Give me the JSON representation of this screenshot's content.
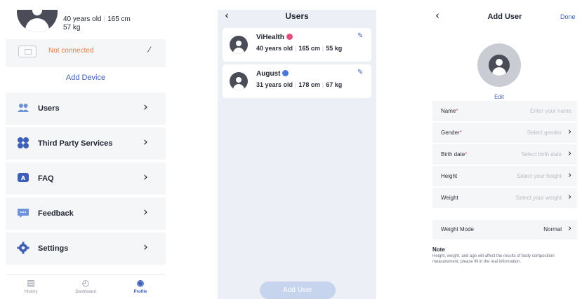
{
  "profile_screen": {
    "user_stats": {
      "age": "40 years old",
      "height": "165 cm",
      "weight": "57 kg"
    },
    "device": {
      "status": "Not connected",
      "edit_icon": "pencil-icon"
    },
    "add_device_label": "Add Device",
    "menu": [
      {
        "label": "Users",
        "icon": "users-icon",
        "color": "#6e93d6"
      },
      {
        "label": "Third Party Services",
        "icon": "grid-icon",
        "color": "#3d5fb7"
      },
      {
        "label": "FAQ",
        "icon": "faq-icon",
        "color": "#3d5fb7"
      },
      {
        "label": "Feedback",
        "icon": "chat-icon",
        "color": "#6e93d6"
      },
      {
        "label": "Settings",
        "icon": "gear-icon",
        "color": "#3d5fb7"
      }
    ],
    "tabs": [
      {
        "label": "History",
        "icon": "history-icon",
        "active": false
      },
      {
        "label": "Dashboard",
        "icon": "dashboard-icon",
        "active": false
      },
      {
        "label": "Profile",
        "icon": "profile-icon",
        "active": true
      }
    ]
  },
  "users_screen": {
    "title": "Users",
    "users": [
      {
        "name": "ViHealth",
        "age": "40 years old",
        "height": "165 cm",
        "weight": "55 kg",
        "gender_color": "#e0517a"
      },
      {
        "name": "August",
        "age": "31 years old",
        "height": "178 cm",
        "weight": "67 kg",
        "gender_color": "#4a78d8"
      }
    ],
    "add_user_label": "Add User"
  },
  "add_user_screen": {
    "title": "Add User",
    "done_label": "Done",
    "edit_label": "Edit",
    "fields": [
      {
        "label": "Name",
        "required": true,
        "placeholder": "Enter your name",
        "arrow": false
      },
      {
        "label": "Gender",
        "required": true,
        "placeholder": "Select gender",
        "arrow": true
      },
      {
        "label": "Birth date",
        "required": true,
        "placeholder": "Select birth date",
        "arrow": true
      },
      {
        "label": "Height",
        "required": false,
        "placeholder": "Select your height",
        "arrow": true
      },
      {
        "label": "Weight",
        "required": false,
        "placeholder": "Select your weight",
        "arrow": true
      }
    ],
    "weight_mode": {
      "label": "Weight Mode",
      "value": "Normal"
    },
    "note": {
      "title": "Note",
      "text": "Height, weight, and age will affect the results of body composition measurement, please fill in the real information."
    }
  },
  "colors": {
    "accent": "#3d5fb7",
    "warning": "#e07a3e",
    "required": "#e0517a",
    "users_bg": "#ecf0f6"
  }
}
